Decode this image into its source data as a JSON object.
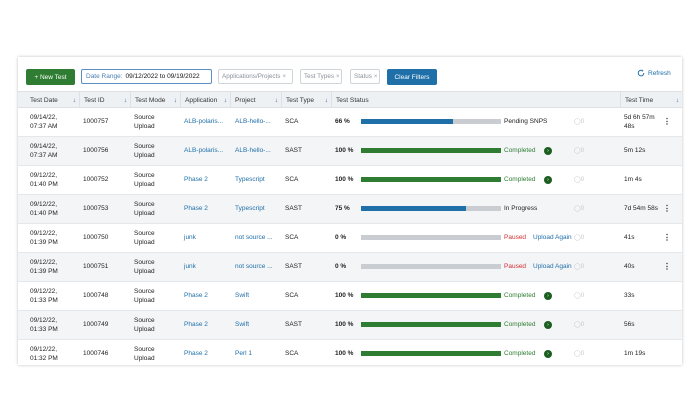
{
  "toolbar": {
    "new_test_label": "+ New Test",
    "date_range_label": "Date Range:",
    "date_range_value": "09/12/2022 to 09/19/2022",
    "filters": [
      {
        "label": "Applications/Projects",
        "clear": "×"
      },
      {
        "label": "Test Types",
        "clear": "×"
      },
      {
        "label": "Status",
        "clear": "×"
      }
    ],
    "clear_filters_label": "Clear Filters",
    "refresh_label": "Refresh"
  },
  "table": {
    "headers": [
      "Test Date",
      "Test ID",
      "Test Mode",
      "Application",
      "Project",
      "Test Type",
      "Test Status",
      "Test Time"
    ],
    "rows": [
      {
        "date1": "09/14/22,",
        "date2": "07:37 AM",
        "id": "1000757",
        "mode1": "Source",
        "mode2": "Upload",
        "application": "ALB-polaris...",
        "project": "ALB-hello-...",
        "type": "SCA",
        "pct": "66 %",
        "progress": 0.66,
        "status": "Pending SNPS",
        "status_kind": "pending",
        "comments": "0",
        "time": "5d 6h 57m 48s",
        "time1": "5d 6h 57m",
        "time2": "48s",
        "menu": "⋮"
      },
      {
        "date1": "09/14/22,",
        "date2": "07:37 AM",
        "id": "1000756",
        "mode1": "Source",
        "mode2": "Upload",
        "application": "ALB-polaris...",
        "project": "ALB-hello-...",
        "type": "SAST",
        "pct": "100 %",
        "progress": 1.0,
        "status": "Completed",
        "status_kind": "completed",
        "comments": "0",
        "time": "5m 12s",
        "menu": ""
      },
      {
        "date1": "09/12/22,",
        "date2": "01:40 PM",
        "id": "1000752",
        "mode1": "Source",
        "mode2": "Upload",
        "application": "Phase 2",
        "project": "Typescript",
        "type": "SCA",
        "pct": "100 %",
        "progress": 1.0,
        "status": "Completed",
        "status_kind": "completed",
        "comments": "0",
        "time": "1m 4s",
        "menu": ""
      },
      {
        "date1": "09/12/22,",
        "date2": "01:40 PM",
        "id": "1000753",
        "mode1": "Source",
        "mode2": "Upload",
        "application": "Phase 2",
        "project": "Typescript",
        "type": "SAST",
        "pct": "75 %",
        "progress": 0.75,
        "status": "In Progress",
        "status_kind": "progress",
        "comments": "0",
        "time": "7d 54m 58s",
        "menu": "⋮"
      },
      {
        "date1": "09/12/22,",
        "date2": "01:39 PM",
        "id": "1000750",
        "mode1": "Source",
        "mode2": "Upload",
        "application": "junk",
        "project": "not source ...",
        "type": "SCA",
        "pct": "0 %",
        "progress": 0.0,
        "status": "Paused",
        "status_kind": "paused",
        "upload_again": "Upload Again",
        "comments": "0",
        "time": "41s",
        "menu": "⋮"
      },
      {
        "date1": "09/12/22,",
        "date2": "01:39 PM",
        "id": "1000751",
        "mode1": "Source",
        "mode2": "Upload",
        "application": "junk",
        "project": "not source ...",
        "type": "SAST",
        "pct": "0 %",
        "progress": 0.0,
        "status": "Paused",
        "status_kind": "paused",
        "upload_again": "Upload Again",
        "comments": "0",
        "time": "40s",
        "menu": "⋮"
      },
      {
        "date1": "09/12/22,",
        "date2": "01:33 PM",
        "id": "1000748",
        "mode1": "Source",
        "mode2": "Upload",
        "application": "Phase 2",
        "project": "Swift",
        "type": "SCA",
        "pct": "100 %",
        "progress": 1.0,
        "status": "Completed",
        "status_kind": "completed",
        "comments": "0",
        "time": "33s",
        "menu": ""
      },
      {
        "date1": "09/12/22,",
        "date2": "01:33 PM",
        "id": "1000749",
        "mode1": "Source",
        "mode2": "Upload",
        "application": "Phase 2",
        "project": "Swift",
        "type": "SAST",
        "pct": "100 %",
        "progress": 1.0,
        "status": "Completed",
        "status_kind": "completed",
        "comments": "0",
        "time": "56s",
        "menu": ""
      },
      {
        "date1": "09/12/22,",
        "date2": "01:32 PM",
        "id": "1000746",
        "mode1": "Source",
        "mode2": "Upload",
        "application": "Phase 2",
        "project": "Perl 1",
        "type": "SCA",
        "pct": "100 %",
        "progress": 1.0,
        "status": "Completed",
        "status_kind": "completed",
        "comments": "0",
        "time": "1m 19s",
        "menu": ""
      }
    ]
  },
  "colors": {
    "primary_green": "#2e7d32",
    "primary_blue": "#1f6fa8",
    "progress_blue": "#1f6fa8",
    "progress_green": "#2e7d32",
    "paused_red": "#d32f2f"
  },
  "icons": {
    "refresh": "refresh-icon",
    "sort": "sort-arrow-icon",
    "completed": "chevron-circle-icon",
    "comment": "comment-icon",
    "menu": "kebab-menu-icon"
  }
}
